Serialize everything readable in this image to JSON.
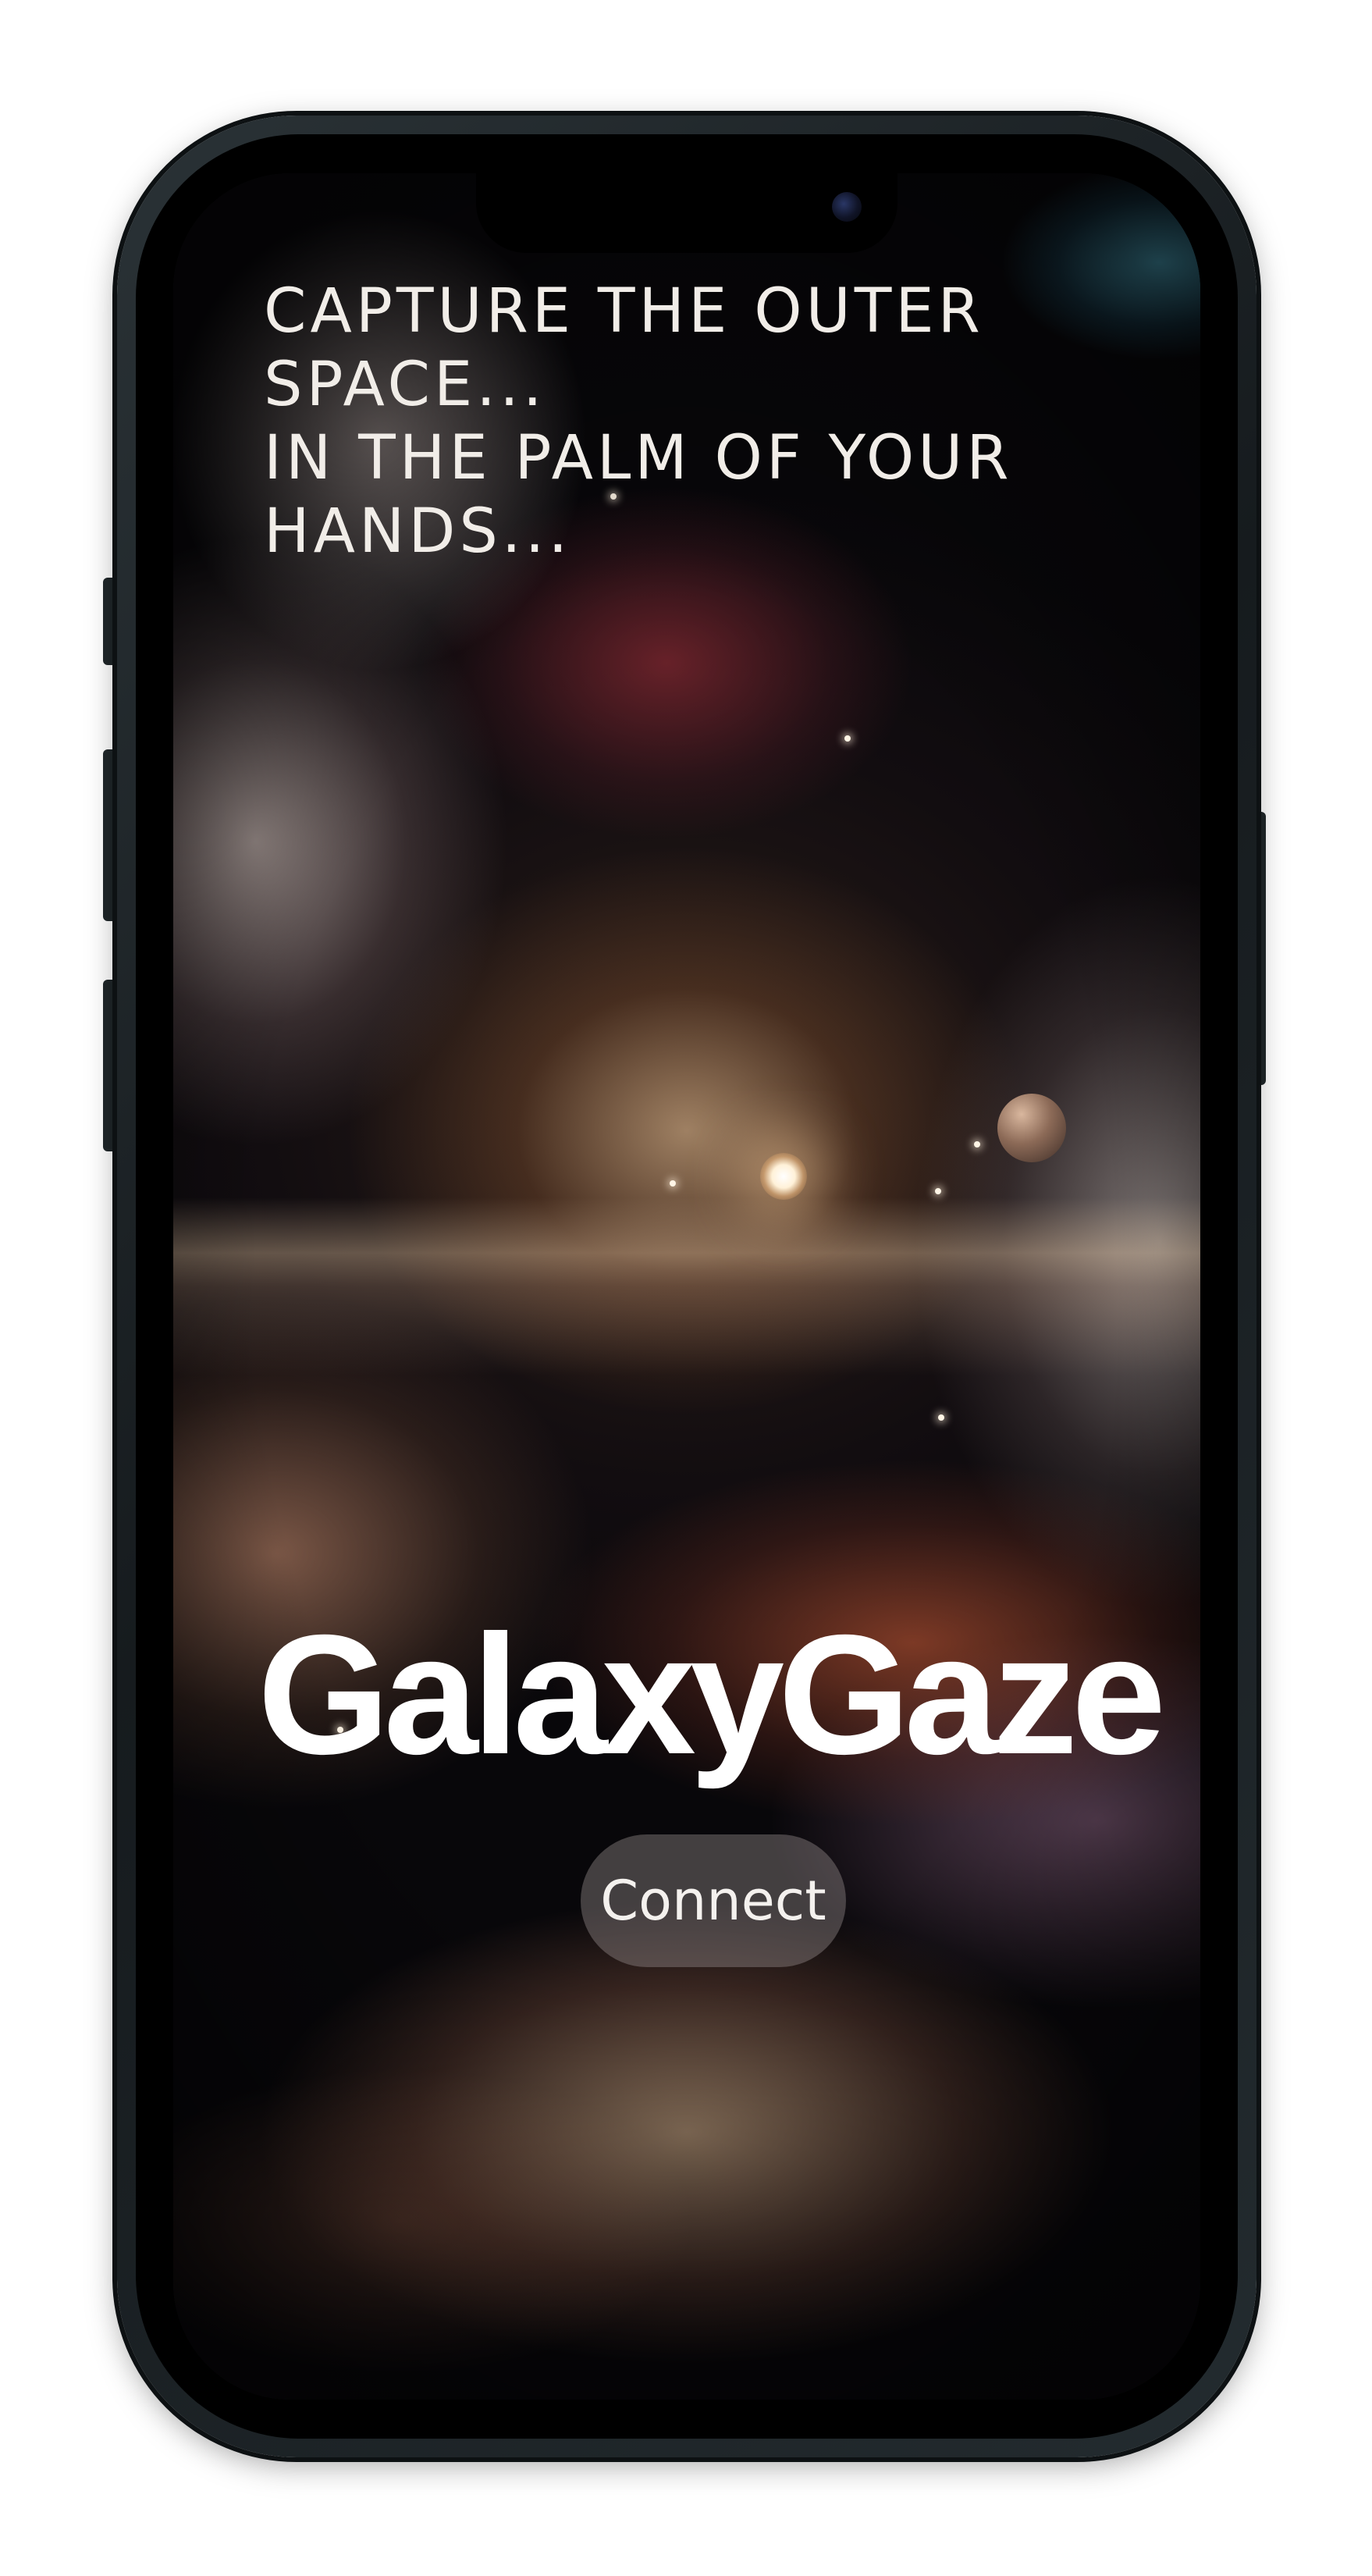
{
  "app": {
    "name": "GalaxyGaze"
  },
  "welcome": {
    "tagline_lines": [
      "CAPTURE THE OUTER",
      "SPACE...",
      "IN THE PALM OF YOUR",
      "HANDS..."
    ],
    "brand_title": "GalaxyGaze",
    "connect_label": "Connect"
  },
  "device": {
    "type": "phone-mockup",
    "frame_color": "#1f2629"
  },
  "background": {
    "description_icon": "space-nebula-art",
    "accent_colors": [
      "#f0d6b4",
      "#8c2d3a",
      "#c95a36",
      "#5ac8e6"
    ]
  }
}
